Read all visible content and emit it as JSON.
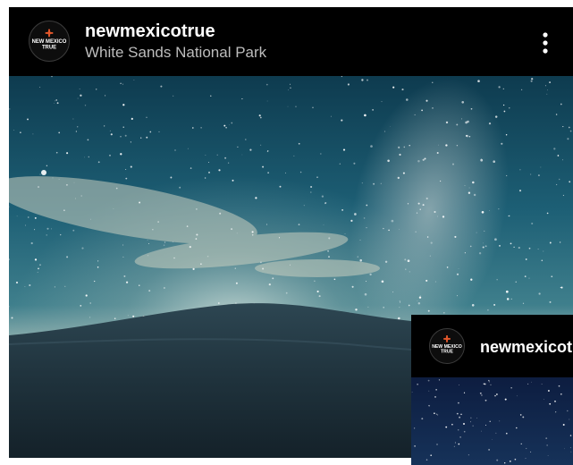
{
  "post": {
    "username": "newmexicotrue",
    "location": "White Sands National Park",
    "avatar_text": [
      "NEW MEXICO",
      "TRUE"
    ],
    "menu_icon": "more-vertical-icon",
    "photo_subject": "starry night sky with milky way over white sand dunes"
  },
  "mini_player": {
    "username": "newmexicot",
    "avatar_text": [
      "NEW MEXICO",
      "TRUE"
    ]
  },
  "colors": {
    "background": "#000000",
    "username": "#ffffff",
    "location": "#bdbdbd",
    "logo_accent": "#e2572b"
  }
}
